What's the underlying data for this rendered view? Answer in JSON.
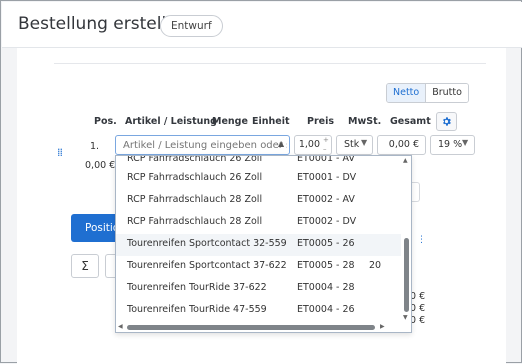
{
  "header": {
    "title": "Bestellung erstellen",
    "status": "Entwurf"
  },
  "price_mode": {
    "options": [
      "Netto",
      "Brutto"
    ],
    "selected": "Netto"
  },
  "table": {
    "columns": [
      "Pos.",
      "Artikel / Leistung",
      "Menge",
      "Einheit",
      "Preis",
      "MwSt.",
      "Gesamt"
    ]
  },
  "row": {
    "pos": "1.",
    "article_placeholder": "Artikel / Leistung eingeben oder suchen",
    "quantity": "1,00",
    "unit": "Stk",
    "price": "0,00 €",
    "vat": "19 %",
    "total": "0,00 €"
  },
  "dropdown": {
    "items": [
      {
        "name": "RCP Fahrradschlauch 26 Zoll",
        "code": "ET0001 - AV",
        "extra": ""
      },
      {
        "name": "RCP Fahrradschlauch 26 Zoll",
        "code": "ET0001 - DV",
        "extra": ""
      },
      {
        "name": "RCP Fahrradschlauch 28 Zoll",
        "code": "ET0002 - AV",
        "extra": ""
      },
      {
        "name": "RCP Fahrradschlauch 28 Zoll",
        "code": "ET0002 - DV",
        "extra": ""
      },
      {
        "name": "Tourenreifen Sportcontact 32-559",
        "code": "ET0005 - 26",
        "extra": ""
      },
      {
        "name": "Tourenreifen Sportcontact 37-622",
        "code": "ET0005 - 28",
        "extra": "20"
      },
      {
        "name": "Tourenreifen TourRide 37-622",
        "code": "ET0004 - 28",
        "extra": ""
      },
      {
        "name": "Tourenreifen TourRide 47-559",
        "code": "ET0004 - 26",
        "extra": ""
      }
    ],
    "hovered_index": 4
  },
  "buttons": {
    "position": "Position",
    "sum": "Σ"
  },
  "summary_values": [
    "0 €",
    "0 €",
    "0 €"
  ],
  "icons": {
    "settings": "gear-icon",
    "drag": "drag-handle-icon",
    "more": "more-vertical-icon"
  }
}
